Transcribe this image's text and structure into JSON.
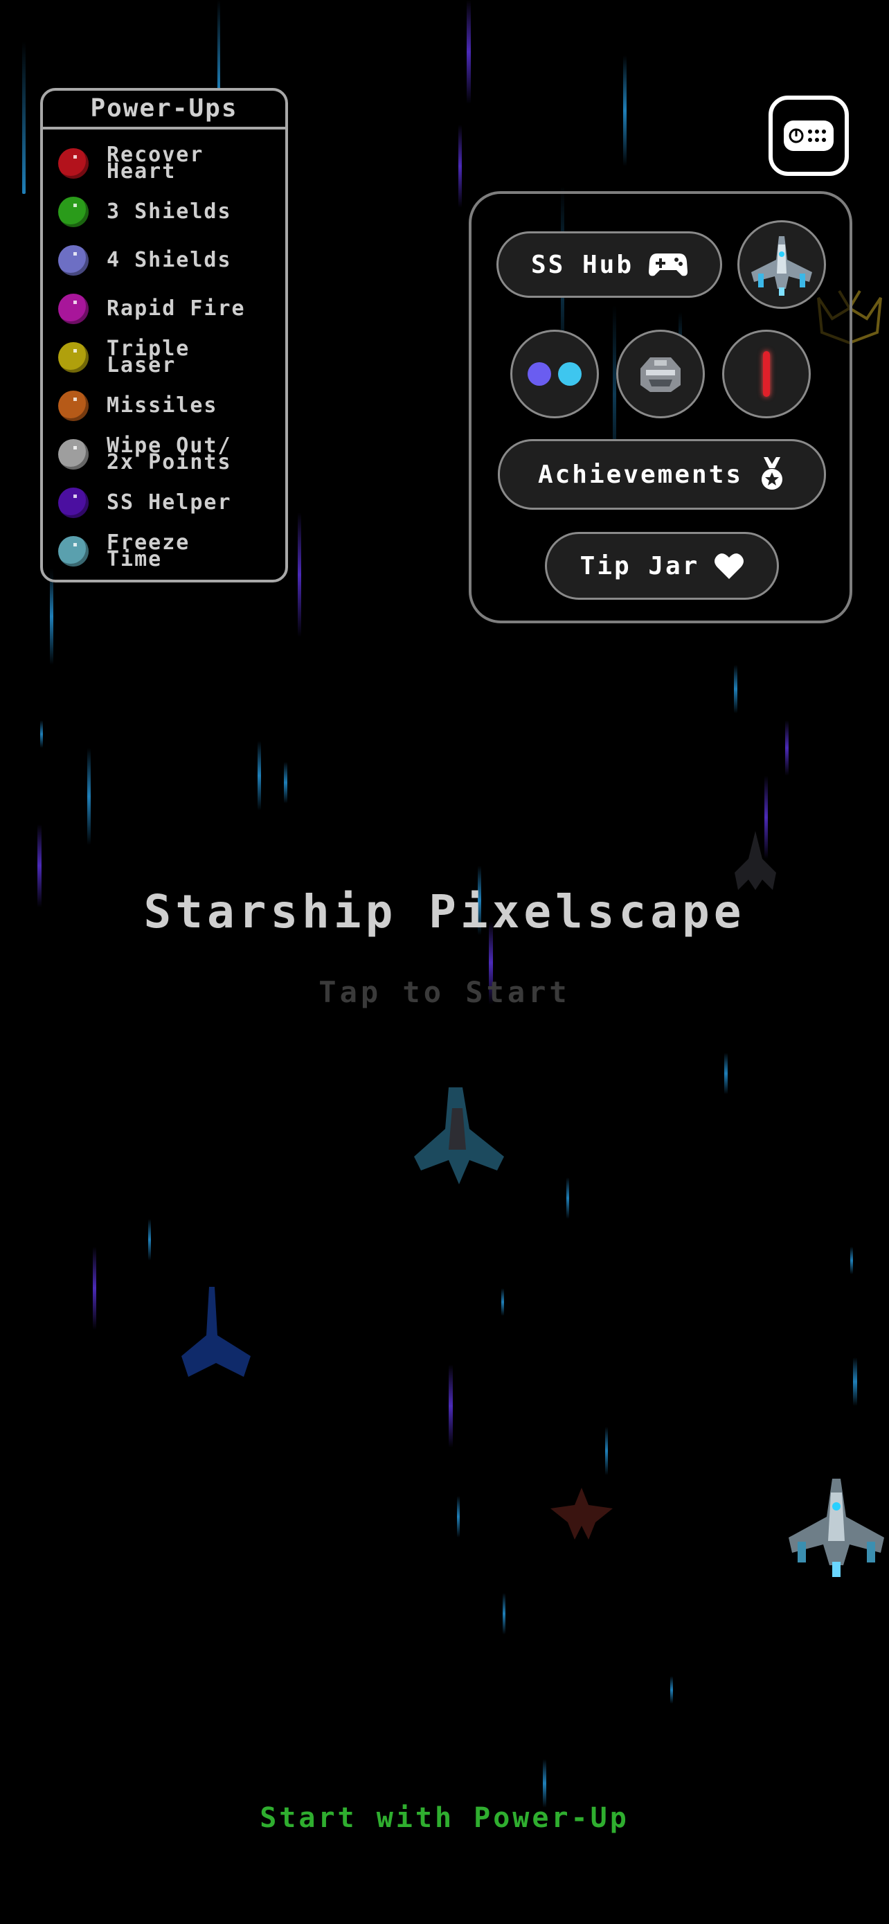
{
  "powerups": {
    "title": "Power-Ups",
    "items": [
      {
        "label": "Recover\nHeart",
        "color": "#b3121c"
      },
      {
        "label": "3 Shields",
        "color": "#2a9b1a"
      },
      {
        "label": "4 Shields",
        "color": "#6d6fc4"
      },
      {
        "label": "Rapid Fire",
        "color": "#a8169a"
      },
      {
        "label": "Triple\nLaser",
        "color": "#b0a00c"
      },
      {
        "label": "Missiles",
        "color": "#b65a18"
      },
      {
        "label": "Wipe Out/\n2x Points",
        "color": "#9e9e9e"
      },
      {
        "label": "SS Helper",
        "color": "#4b0fa0"
      },
      {
        "label": "Freeze\nTime",
        "color": "#5aa0ae"
      }
    ]
  },
  "controller_button": {
    "icon": "controller-settings-icon"
  },
  "menu": {
    "ss_hub_label": "SS Hub",
    "ss_hub_icon": "gamepad-icon",
    "ship_select_icon": "starship-icon",
    "color_select_icon": "color-dots-icon",
    "color_dot_1": "#6a5df0",
    "color_dot_2": "#3ec6ef",
    "skin_select_icon": "armor-icon",
    "laser_select_icon": "red-laser-icon",
    "laser_color": "#e0202a",
    "achievements_label": "Achievements",
    "achievements_icon": "medal-icon",
    "tip_jar_label": "Tip Jar",
    "tip_jar_icon": "heart-icon"
  },
  "title": "Starship Pixelscape",
  "tap_to_start": "Tap to Start",
  "start_with_powerup": "Start with Power-Up",
  "colors": {
    "accent_green": "#2fae2f",
    "panel_border": "#a8a8a8",
    "streak_blue": "#1f7fb8",
    "streak_purple": "#4b2ab8"
  }
}
